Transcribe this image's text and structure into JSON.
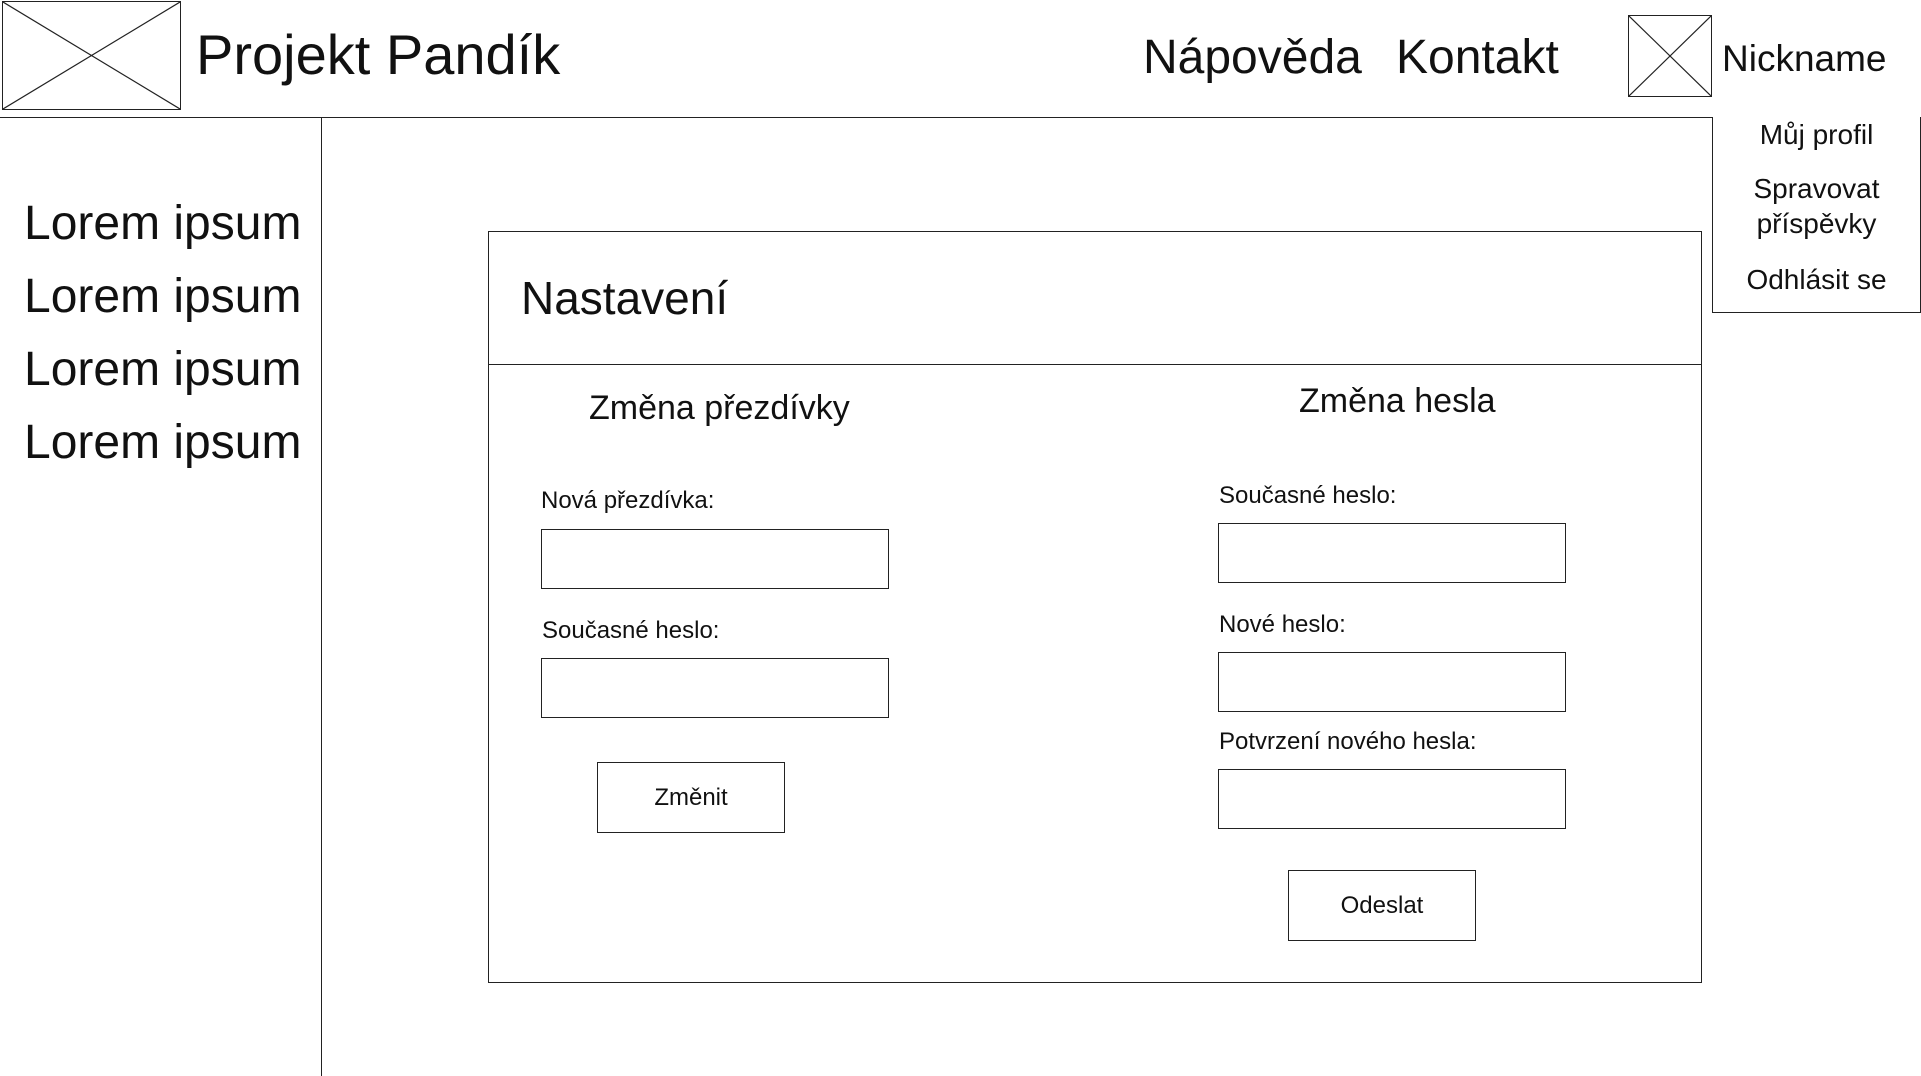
{
  "header": {
    "site_title": "Projekt Pandík",
    "nav": [
      {
        "label": "Nápověda"
      },
      {
        "label": "Kontakt"
      }
    ],
    "user": {
      "nickname": "Nickname"
    }
  },
  "user_menu": {
    "items": [
      {
        "label": "Můj profil"
      },
      {
        "label": "Spravovat příspěvky"
      },
      {
        "label": "Odhlásit se"
      }
    ]
  },
  "sidebar": {
    "items": [
      {
        "label": "Lorem ipsum"
      },
      {
        "label": "Lorem ipsum"
      },
      {
        "label": "Lorem ipsum"
      },
      {
        "label": "Lorem ipsum"
      }
    ]
  },
  "settings": {
    "title": "Nastavení",
    "nickname_change": {
      "title": "Změna přezdívky",
      "new_nickname_label": "Nová přezdívka:",
      "new_nickname_value": "",
      "current_password_label": "Současné heslo:",
      "current_password_value": "",
      "submit_label": "Změnit"
    },
    "password_change": {
      "title": "Změna hesla",
      "current_password_label": "Současné heslo:",
      "current_password_value": "",
      "new_password_label": "Nové heslo:",
      "new_password_value": "",
      "confirm_password_label": "Potvrzení nového hesla:",
      "confirm_password_value": "",
      "submit_label": "Odeslat"
    }
  }
}
